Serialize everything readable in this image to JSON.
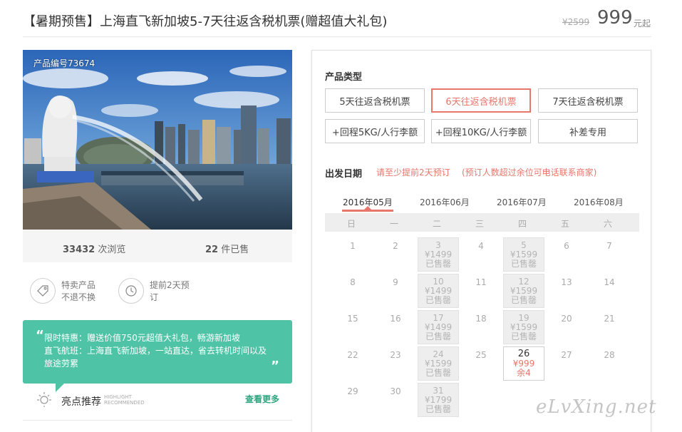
{
  "header": {
    "title": "【暑期预售】上海直飞新加坡5-7天往返含税机票(赠超值大礼包)",
    "original_price": "¥2599",
    "price": "999",
    "price_unit": "元起"
  },
  "product": {
    "number_label": "产品编号73674",
    "views_count": "33432",
    "views_label": "次浏览",
    "sold_count": "22",
    "sold_label": "件已售"
  },
  "features": [
    {
      "icon": "tag-icon",
      "line1": "特卖产品",
      "line2": "不退不换"
    },
    {
      "icon": "clock-icon",
      "line1": "提前2天预",
      "line2": "订"
    }
  ],
  "promo": {
    "line1": "限时特惠：赠送价值750元超值大礼包，畅游新加坡",
    "line2": "直飞航班：上海直飞新加坡，一站直达，省去转机时间以及",
    "line3": "旅途劳累",
    "open_quote": "“",
    "close_quote": "”"
  },
  "highlights": {
    "title": "亮点推荐",
    "en_line1": "HIGHLIGHT",
    "en_line2": "RECOMMENDED",
    "more_label": "查看更多"
  },
  "product_type": {
    "title": "产品类型",
    "options": [
      "5天往返含税机票",
      "6天往返含税机票",
      "7天往返含税机票",
      "+回程5KG/人行李额",
      "+回程10KG/人行李额",
      "补差专用"
    ],
    "selected": "6天往返含税机票"
  },
  "departure": {
    "title": "出发日期",
    "note1": "请至少提前2天预订",
    "note2": "(预订人数超过余位可电话联系商家)"
  },
  "months": [
    "2016年05月",
    "2016年06月",
    "2016年07月",
    "2016年08月"
  ],
  "active_month": "2016年05月",
  "weekdays": [
    "日",
    "一",
    "二",
    "三",
    "四",
    "五",
    "六"
  ],
  "calendar": [
    {
      "day": "1"
    },
    {
      "day": "2"
    },
    {
      "day": "3",
      "price": "¥1499",
      "status": "已售罄"
    },
    {
      "day": "4"
    },
    {
      "day": "5",
      "price": "¥1599",
      "status": "已售罄"
    },
    {
      "day": "6"
    },
    {
      "day": "7"
    },
    {
      "day": "8"
    },
    {
      "day": "9"
    },
    {
      "day": "10",
      "price": "¥1499",
      "status": "已售罄"
    },
    {
      "day": "11"
    },
    {
      "day": "12",
      "price": "¥1599",
      "status": "已售罄"
    },
    {
      "day": "13"
    },
    {
      "day": "14"
    },
    {
      "day": "15"
    },
    {
      "day": "16"
    },
    {
      "day": "17",
      "price": "¥1499",
      "status": "已售罄"
    },
    {
      "day": "18"
    },
    {
      "day": "19",
      "price": "¥1599",
      "status": "已售罄"
    },
    {
      "day": "20"
    },
    {
      "day": "21"
    },
    {
      "day": "22"
    },
    {
      "day": "23"
    },
    {
      "day": "24",
      "price": "¥1599",
      "status": "已售罄"
    },
    {
      "day": "25"
    },
    {
      "day": "26",
      "price": "¥999",
      "status": "余4",
      "available": true
    },
    {
      "day": "27"
    },
    {
      "day": "28"
    },
    {
      "day": "29"
    },
    {
      "day": "30"
    },
    {
      "day": "31",
      "price": "¥1799",
      "status": "已售罄"
    }
  ],
  "watermark": "eLvXing.net",
  "colors": {
    "accent": "#e8766b",
    "promo_green": "#4ec3a5",
    "link_green": "#2ea57f"
  }
}
